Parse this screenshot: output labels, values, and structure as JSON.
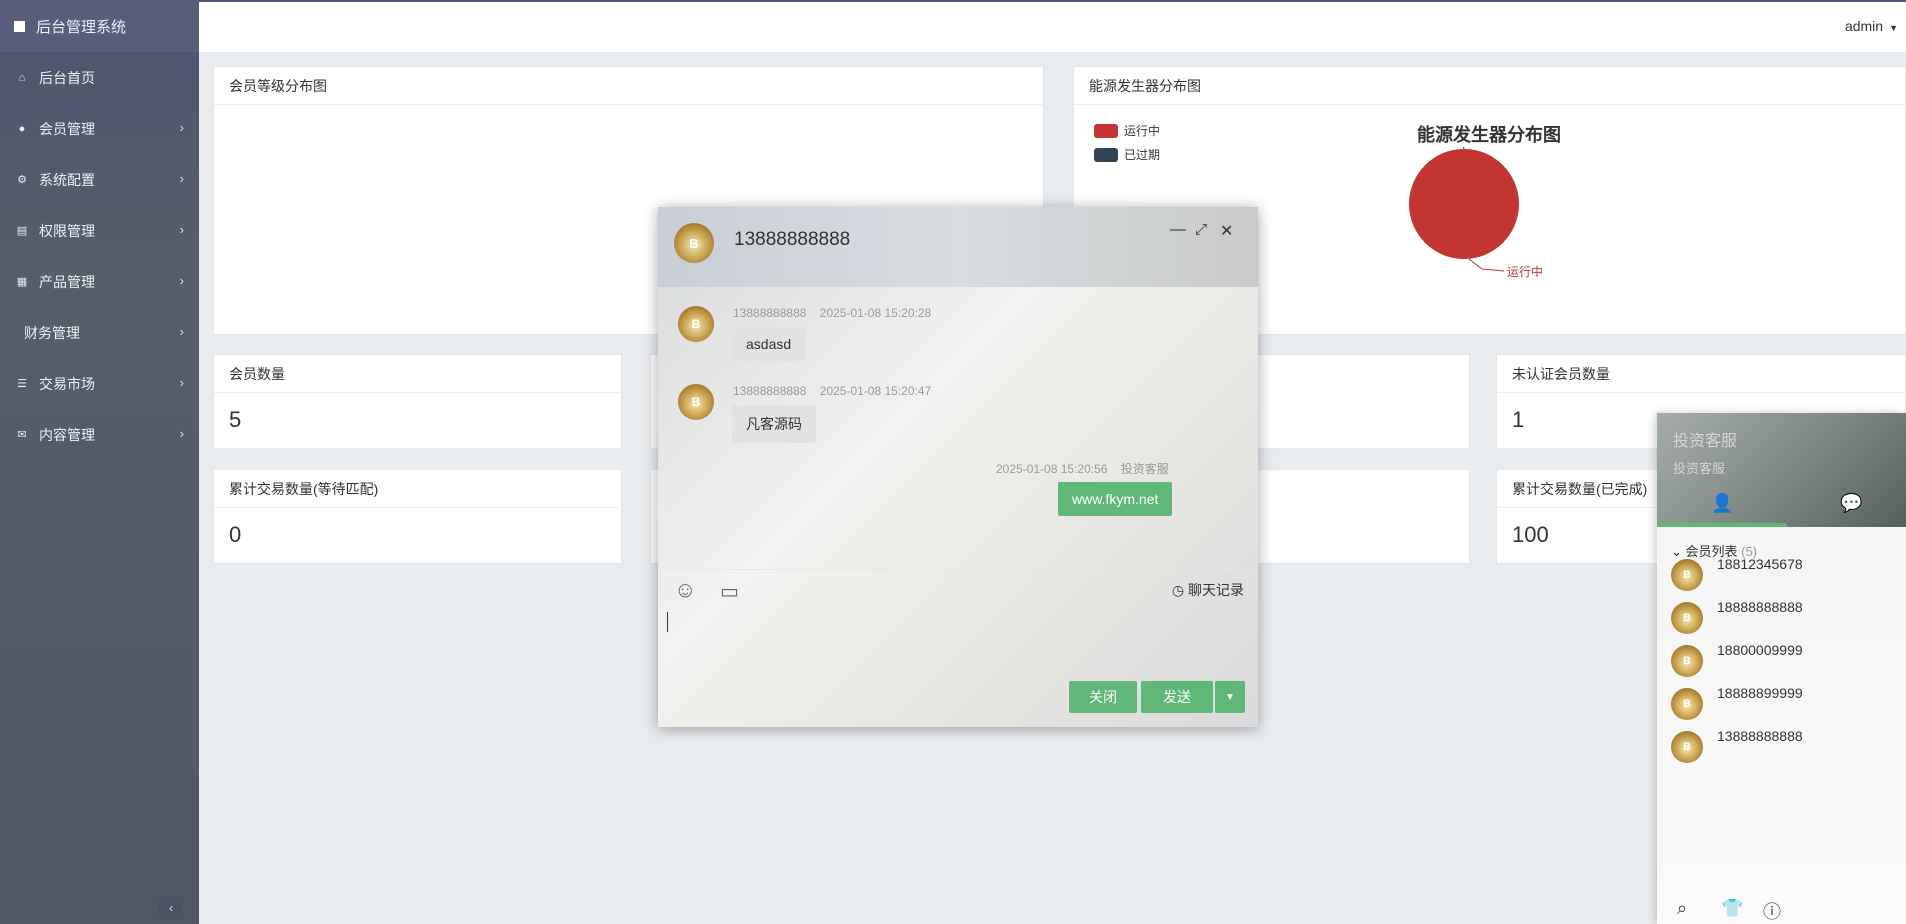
{
  "app": {
    "title": "后台管理系统",
    "user": "admin"
  },
  "sidebar": {
    "items": [
      {
        "label": "后台首页",
        "icon": "home-icon",
        "glyph": "⌂",
        "arrow": false
      },
      {
        "label": "会员管理",
        "icon": "user-icon",
        "glyph": "●",
        "arrow": true
      },
      {
        "label": "系统配置",
        "icon": "gears-icon",
        "glyph": "⚙",
        "arrow": true
      },
      {
        "label": "权限管理",
        "icon": "list-box-icon",
        "glyph": "▤",
        "arrow": true
      },
      {
        "label": "产品管理",
        "icon": "windows-icon",
        "glyph": "▦",
        "arrow": true
      },
      {
        "label": "财务管理",
        "icon": "",
        "glyph": "",
        "arrow": true
      },
      {
        "label": "交易市场",
        "icon": "bars-icon",
        "glyph": "☰",
        "arrow": true
      },
      {
        "label": "内容管理",
        "icon": "envelope-icon",
        "glyph": "✉",
        "arrow": true
      }
    ],
    "collapse_glyph": "‹"
  },
  "panels": {
    "member_level": {
      "title": "会员等级分布图"
    },
    "energy": {
      "title": "能源发生器分布图"
    },
    "member_count": {
      "title": "会员数量",
      "value": "5"
    },
    "unverified": {
      "title": "未认证会员数量",
      "value": "1"
    },
    "trade_pending": {
      "title": "累计交易数量(等待匹配)",
      "value": "0"
    },
    "trade_done": {
      "title": "累计交易数量(已完成)",
      "value": "100"
    }
  },
  "chart_data": {
    "type": "pie",
    "title": "能源发生器分布图",
    "series": [
      {
        "name": "运行中",
        "value": 100,
        "color": "#c23531"
      },
      {
        "name": "已过期",
        "value": 0,
        "color": "#2f4554"
      }
    ],
    "legend_position": "top-left"
  },
  "chat": {
    "title": "13888888888",
    "messages": [
      {
        "user": "13888888888",
        "time": "2025-01-08 15:20:28",
        "text": "asdasd"
      },
      {
        "user": "13888888888",
        "time": "2025-01-08 15:20:47",
        "text": "凡客源码"
      },
      {
        "user": "投资客服",
        "time": "2025-01-08 15:20:56",
        "text": "www.fkym.net"
      }
    ],
    "history_label": "聊天记录",
    "close_label": "关闭",
    "send_label": "发送"
  },
  "side_panel": {
    "title": "投资客服",
    "subtitle": "投资客服",
    "list_title": "会员列表",
    "list_count": "(5)",
    "friends": [
      "18812345678",
      "18888888888",
      "18800009999",
      "18888899999",
      "13888888888"
    ]
  }
}
